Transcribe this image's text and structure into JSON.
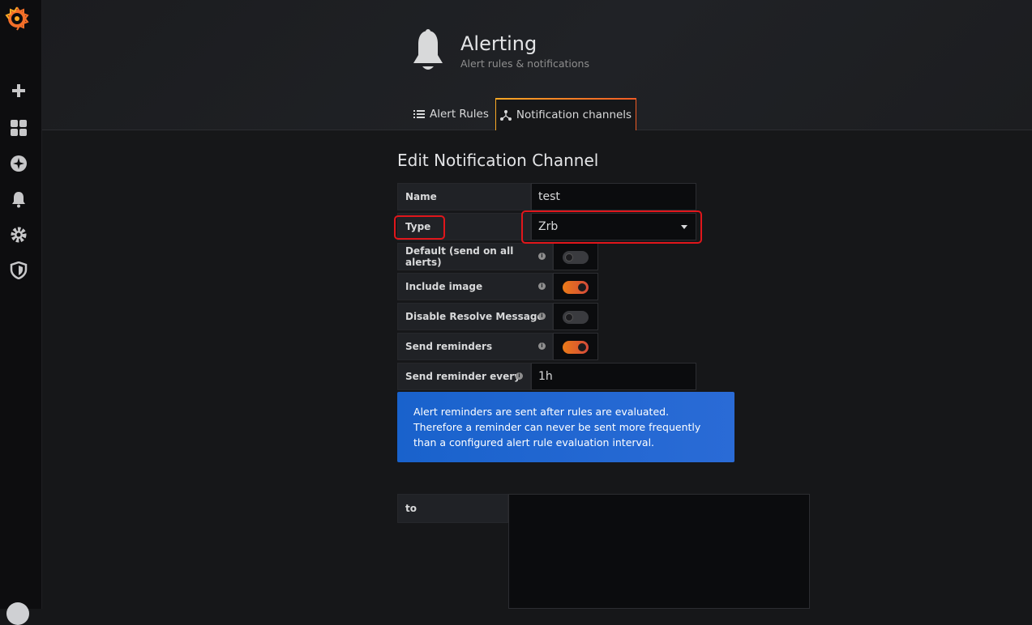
{
  "sidebar": {
    "items": [
      {
        "name": "create",
        "icon": "plus-icon"
      },
      {
        "name": "dashboards",
        "icon": "dashboard-grid-icon"
      },
      {
        "name": "explore",
        "icon": "compass-icon"
      },
      {
        "name": "alerting",
        "icon": "bell-icon"
      },
      {
        "name": "configuration",
        "icon": "gear-icon"
      },
      {
        "name": "server-admin",
        "icon": "shield-icon"
      }
    ]
  },
  "header": {
    "title": "Alerting",
    "subtitle": "Alert rules & notifications",
    "icon": "bell-icon"
  },
  "tabs": [
    {
      "label": "Alert Rules",
      "icon": "list-icon",
      "active": false
    },
    {
      "label": "Notification channels",
      "icon": "channels-icon",
      "active": true
    }
  ],
  "form": {
    "title": "Edit Notification Channel",
    "name_label": "Name",
    "name_value": "test",
    "type_label": "Type",
    "type_value": "Zrb",
    "default_label": "Default (send on all alerts)",
    "default_on": false,
    "include_image_label": "Include image",
    "include_image_on": true,
    "disable_resolve_label": "Disable Resolve Message",
    "disable_resolve_on": false,
    "send_reminders_label": "Send reminders",
    "send_reminders_on": true,
    "reminder_every_label": "Send reminder every",
    "reminder_every_value": "1h",
    "info_text": "Alert reminders are sent after rules are evaluated. Therefore a reminder can never be sent more frequently than a configured alert rule evaluation interval.",
    "to_label": "to",
    "to_value": ""
  },
  "colors": {
    "accent_orange": "#eb7b18",
    "info_blue": "#1962cc",
    "highlight_red": "#e0161b"
  }
}
